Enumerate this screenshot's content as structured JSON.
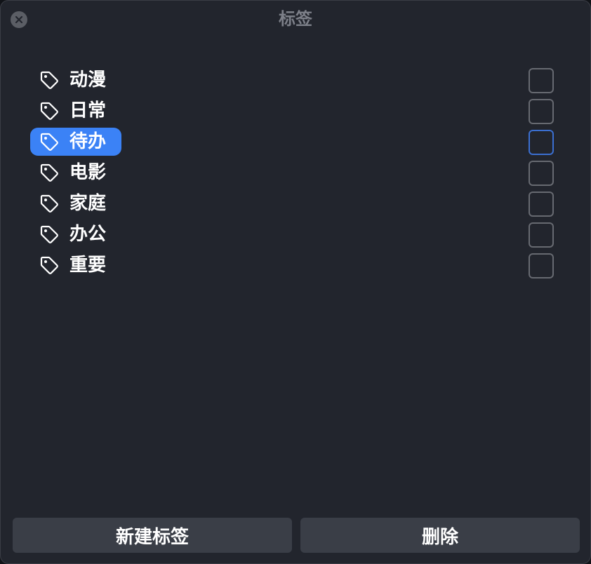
{
  "window": {
    "title": "标签"
  },
  "tags": [
    {
      "label": "动漫",
      "selected": false,
      "checked": false
    },
    {
      "label": "日常",
      "selected": false,
      "checked": false
    },
    {
      "label": "待办",
      "selected": true,
      "checked": false
    },
    {
      "label": "电影",
      "selected": false,
      "checked": false
    },
    {
      "label": "家庭",
      "selected": false,
      "checked": false
    },
    {
      "label": "办公",
      "selected": false,
      "checked": false
    },
    {
      "label": "重要",
      "selected": false,
      "checked": false
    }
  ],
  "footer": {
    "new_tag_label": "新建标签",
    "delete_label": "删除"
  },
  "icons": {
    "close": "close-icon",
    "tag": "tag-icon"
  },
  "colors": {
    "accent": "#3b82f6",
    "background": "#22252d",
    "button": "#3a3e47"
  }
}
